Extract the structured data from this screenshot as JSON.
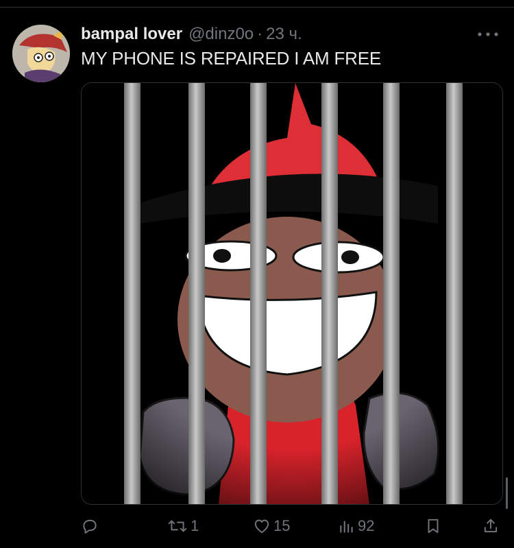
{
  "tweet": {
    "display_name": "bampal lover",
    "handle": "@dinz0o",
    "separator": "·",
    "time": "23 ч.",
    "text": "MY PHONE IS REPAIRED I AM FREE"
  },
  "actions": {
    "reply": {
      "icon": "reply-icon",
      "count": ""
    },
    "retweet": {
      "icon": "retweet-icon",
      "count": "1"
    },
    "like": {
      "icon": "heart-icon",
      "count": "15"
    },
    "views": {
      "icon": "views-icon",
      "count": "92"
    },
    "bookmark": {
      "icon": "bookmark-icon"
    },
    "share": {
      "icon": "share-icon"
    }
  },
  "colors": {
    "background": "#000000",
    "text": "#e7e9ea",
    "muted": "#71767b",
    "border": "#2f3336"
  }
}
